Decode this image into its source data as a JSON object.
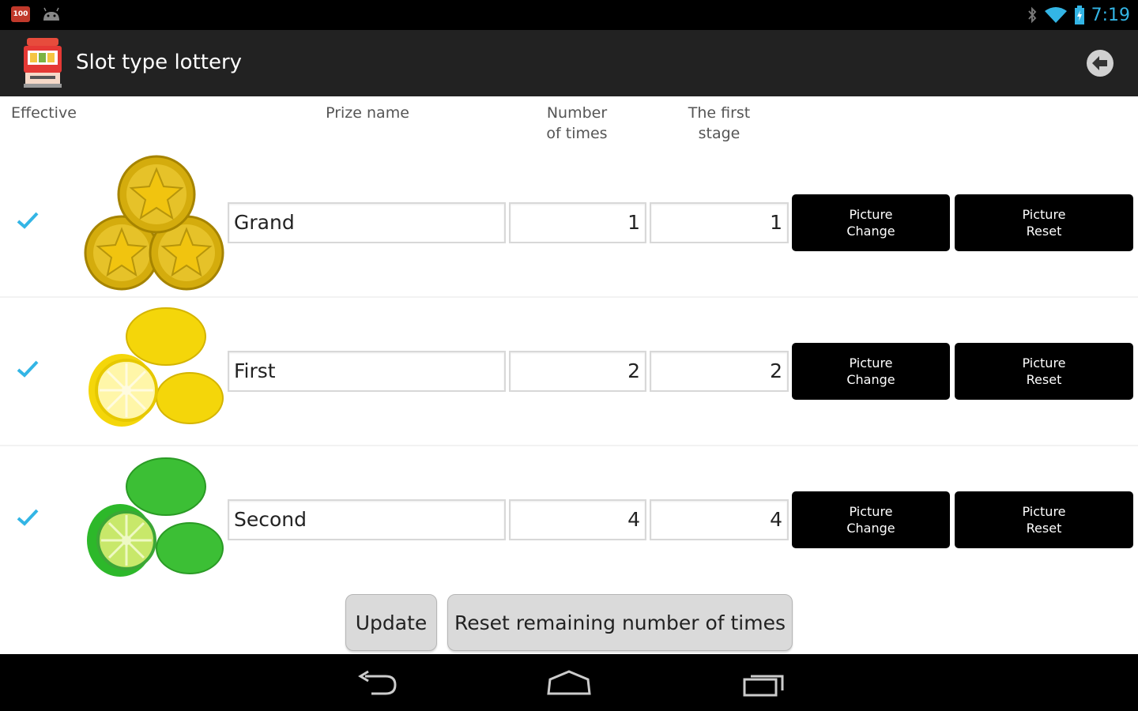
{
  "status_bar": {
    "notification_badge": "100",
    "time": "7:19",
    "icons": [
      "notification-badge-icon",
      "android-icon",
      "bluetooth-icon",
      "wifi-icon",
      "battery-icon"
    ]
  },
  "action_bar": {
    "title": "Slot type lottery",
    "app_icon": "slot-machine-icon",
    "back_icon": "back-arrow-icon"
  },
  "table": {
    "headers": {
      "effective": "Effective",
      "prize_name": "Prize name",
      "number_of_times": "Number\nof times",
      "first_stage": "The first\nstage"
    },
    "rows": [
      {
        "effective": true,
        "picture": "gold-coins-icon",
        "prize_name": "Grand",
        "number_of_times": "1",
        "first_stage": "1",
        "picture_change": "Picture\nChange",
        "picture_reset": "Picture\nReset"
      },
      {
        "effective": true,
        "picture": "lemons-icon",
        "prize_name": "First",
        "number_of_times": "2",
        "first_stage": "2",
        "picture_change": "Picture\nChange",
        "picture_reset": "Picture\nReset"
      },
      {
        "effective": true,
        "picture": "limes-icon",
        "prize_name": "Second",
        "number_of_times": "4",
        "first_stage": "4",
        "picture_change": "Picture\nChange",
        "picture_reset": "Picture\nReset"
      }
    ]
  },
  "buttons": {
    "update": "Update",
    "reset_remaining": "Reset remaining number of times"
  },
  "colors": {
    "accent": "#33b5e5",
    "action_bar": "#222222",
    "button_black": "#000000"
  },
  "nav_bar": {
    "icons": [
      "back-nav-icon",
      "home-nav-icon",
      "recents-nav-icon"
    ]
  }
}
